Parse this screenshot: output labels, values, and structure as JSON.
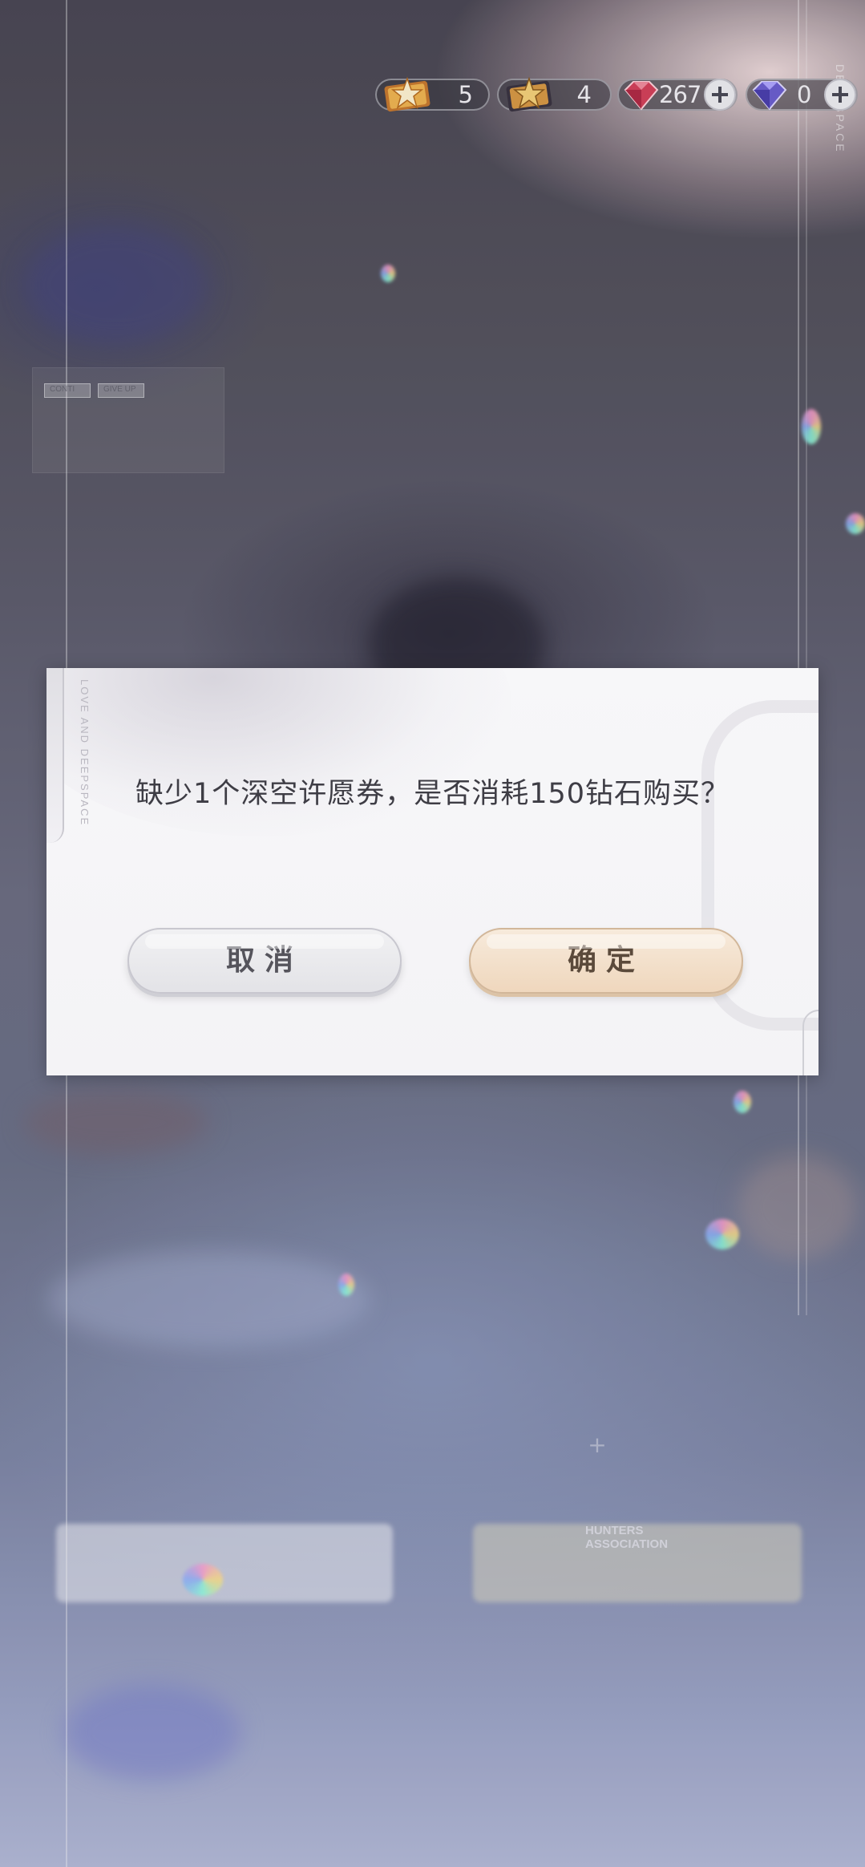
{
  "resources": [
    {
      "icon": "gold-wish-ticket-icon",
      "value": "5"
    },
    {
      "icon": "dark-wish-ticket-icon",
      "value": "4"
    },
    {
      "icon": "red-diamond-icon",
      "value": "267"
    },
    {
      "icon": "purple-diamond-icon",
      "value": "0"
    }
  ],
  "dialog": {
    "message": "缺少1个深空许愿券，是否消耗150钻石购买？",
    "cancel_label": "取消",
    "confirm_label": "确定",
    "ribbon_text": "LOVE AND DEEPSPACE"
  },
  "background": {
    "tag_left": "CONTI",
    "tag_right": "GIVE UP",
    "card_title": "HUNTERS ASSOCIATION",
    "side_text": "DEEPSPACE"
  },
  "colors": {
    "dialog_bg": "#f6f5f8",
    "confirm_bg": "#f0dcc4",
    "cancel_bg": "#e8e8ec",
    "text": "#3e3d45"
  }
}
